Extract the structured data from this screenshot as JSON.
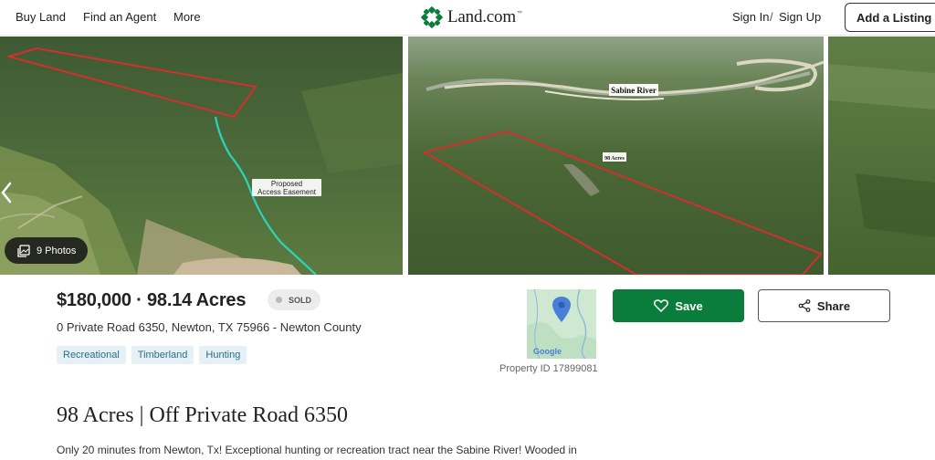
{
  "header": {
    "nav": [
      "Buy Land",
      "Find an Agent",
      "More"
    ],
    "logo_text": "Land.com",
    "logo_tm": "™",
    "sign_in": "Sign In",
    "separator": "/",
    "sign_up": "Sign Up",
    "add_listing": "Add a Listing"
  },
  "gallery": {
    "photos_button_label": "9 Photos",
    "photo1_annotation": [
      "Proposed",
      "Access Easement"
    ],
    "photo2_river_label": "Sabine River",
    "photo2_acres_label": "98 Acres"
  },
  "listing": {
    "price_acres": "$180,000 · 98.14 Acres",
    "status": "SOLD",
    "address": "0 Private Road 6350, Newton, TX 75966 - Newton County",
    "tags": [
      "Recreational",
      "Timberland",
      "Hunting"
    ],
    "property_id": "Property ID 17899081",
    "map_brand": "Google",
    "save_label": "Save",
    "share_label": "Share"
  },
  "details": {
    "heading": "98 Acres | Off Private Road 6350",
    "description": "Only 20 minutes from Newton, Tx! Exceptional hunting or recreation tract near the Sabine River! Wooded in"
  },
  "colors": {
    "accent_green": "#0a7c3b",
    "tag_bg": "#e6f1f6",
    "tag_text": "#2d6b8a",
    "boundary_red": "#d32f2f"
  },
  "icons": [
    "land-logo-icon",
    "chevron-left-icon",
    "photos-icon",
    "map-pin-icon",
    "heart-icon",
    "share-icon"
  ]
}
